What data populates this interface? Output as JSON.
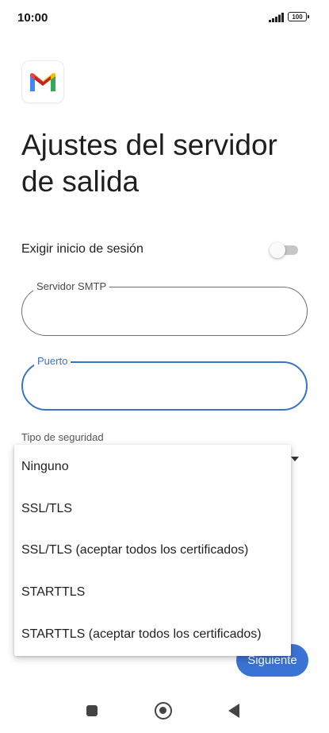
{
  "status_bar": {
    "time": "10:00",
    "battery": "100"
  },
  "app": {
    "logo_icon": "gmail-logo-icon"
  },
  "header": {
    "title": "Ajustes del servidor de salida"
  },
  "settings": {
    "require_signin_label": "Exigir inicio de sesión",
    "require_signin_enabled": false
  },
  "fields": {
    "smtp_server": {
      "label": "Servidor SMTP",
      "value": ""
    },
    "port": {
      "label": "Puerto",
      "value": ""
    }
  },
  "security": {
    "label": "Tipo de seguridad",
    "options": [
      "Ninguno",
      "SSL/TLS",
      "SSL/TLS (aceptar todos los certificados)",
      "STARTTLS",
      "STARTTLS (aceptar todos los certificados)"
    ]
  },
  "actions": {
    "next_label": "Siguiente"
  },
  "colors": {
    "accent": "#3b73d4",
    "focus_border": "#3b73c8"
  },
  "nav": {
    "icons": [
      "recents-square-icon",
      "home-circle-icon",
      "back-triangle-icon"
    ]
  }
}
